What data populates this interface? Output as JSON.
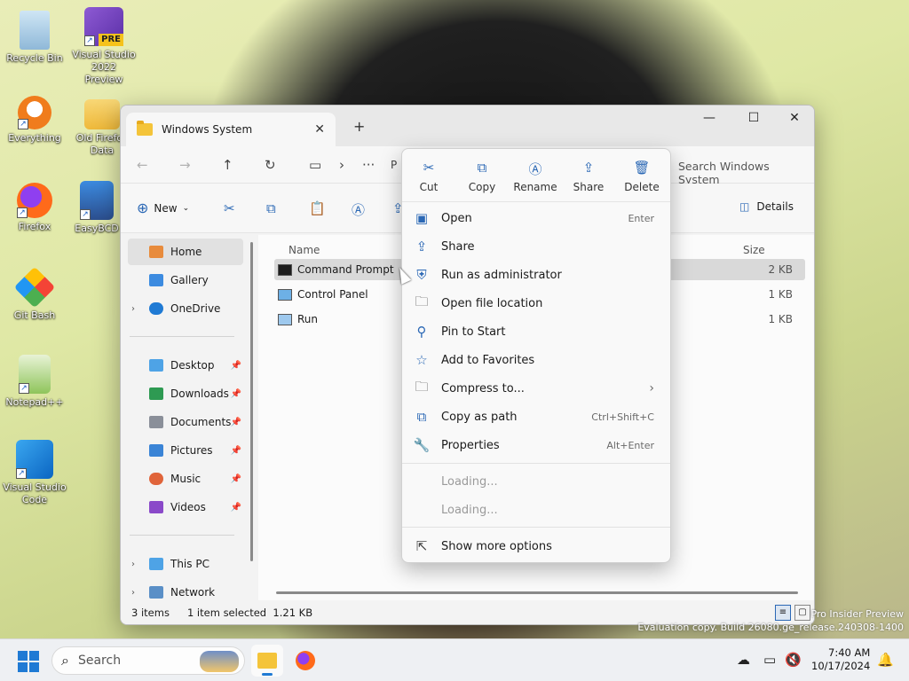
{
  "desktop": {
    "icons": [
      {
        "label": "Recycle Bin",
        "icon": "recycle-bin-icon"
      },
      {
        "label": "Visual Studio 2022 Preview",
        "icon": "visual-studio-preview-icon",
        "badge": "PRE"
      },
      {
        "label": "Everything",
        "icon": "everything-search-icon"
      },
      {
        "label": "Old Firefox Data",
        "icon": "folder-icon"
      },
      {
        "label": "Firefox",
        "icon": "firefox-icon"
      },
      {
        "label": "EasyBCD",
        "icon": "easybcd-icon"
      },
      {
        "label": "Git Bash",
        "icon": "git-bash-icon"
      },
      {
        "label": "Notepad++",
        "icon": "notepad-plus-plus-icon"
      },
      {
        "label": "Visual Studio Code",
        "icon": "vscode-icon"
      }
    ],
    "watermark": {
      "line1": "Pro Insider Preview",
      "line2": "Evaluation copy. Build 26080.ge_release.240308-1400"
    }
  },
  "explorer": {
    "tab_title": "Windows System",
    "search_placeholder": "Search Windows System",
    "breadcrumb_partial": "P",
    "toolbar": {
      "new_label": "New",
      "details_label": "Details"
    },
    "sidebar": {
      "home": "Home",
      "gallery": "Gallery",
      "onedrive": "OneDrive",
      "pinned": [
        "Desktop",
        "Downloads",
        "Documents",
        "Pictures",
        "Music",
        "Videos"
      ],
      "this_pc": "This PC",
      "network": "Network"
    },
    "columns": {
      "name": "Name",
      "size": "Size"
    },
    "files": [
      {
        "name": "Command Prompt",
        "type_partial": "t",
        "size": "2 KB",
        "selected": true
      },
      {
        "name": "Control Panel",
        "type_partial": "t",
        "size": "1 KB",
        "selected": false
      },
      {
        "name": "Run",
        "type_partial": "t",
        "size": "1 KB",
        "selected": false
      }
    ],
    "status": {
      "items": "3 items",
      "selected": "1 item selected  1.21 KB"
    }
  },
  "context_menu": {
    "quick_actions": [
      {
        "label": "Cut",
        "icon": "scissors-icon"
      },
      {
        "label": "Copy",
        "icon": "copy-icon"
      },
      {
        "label": "Rename",
        "icon": "rename-icon"
      },
      {
        "label": "Share",
        "icon": "share-icon"
      },
      {
        "label": "Delete",
        "icon": "trash-icon"
      }
    ],
    "items": [
      {
        "label": "Open",
        "shortcut": "Enter",
        "icon": "open-window-icon"
      },
      {
        "label": "Share",
        "shortcut": "",
        "icon": "share-icon"
      },
      {
        "label": "Run as administrator",
        "shortcut": "",
        "icon": "shield-icon"
      },
      {
        "label": "Open file location",
        "shortcut": "",
        "icon": "folder-outline-icon"
      },
      {
        "label": "Pin to Start",
        "shortcut": "",
        "icon": "pin-icon"
      },
      {
        "label": "Add to Favorites",
        "shortcut": "",
        "icon": "star-icon"
      },
      {
        "label": "Compress to...",
        "shortcut": "",
        "icon": "zip-icon",
        "submenu": true
      },
      {
        "label": "Copy as path",
        "shortcut": "Ctrl+Shift+C",
        "icon": "copy-path-icon"
      },
      {
        "label": "Properties",
        "shortcut": "Alt+Enter",
        "icon": "wrench-icon"
      }
    ],
    "loading": [
      "Loading...",
      "Loading..."
    ],
    "more": "Show more options"
  },
  "taskbar": {
    "search_label": "Search",
    "time": "7:40 AM",
    "date": "10/17/2024"
  },
  "colors": {
    "accent": "#1f7ad4",
    "icon_blue": "#2b68b5",
    "selection": "#d9d9d9"
  }
}
